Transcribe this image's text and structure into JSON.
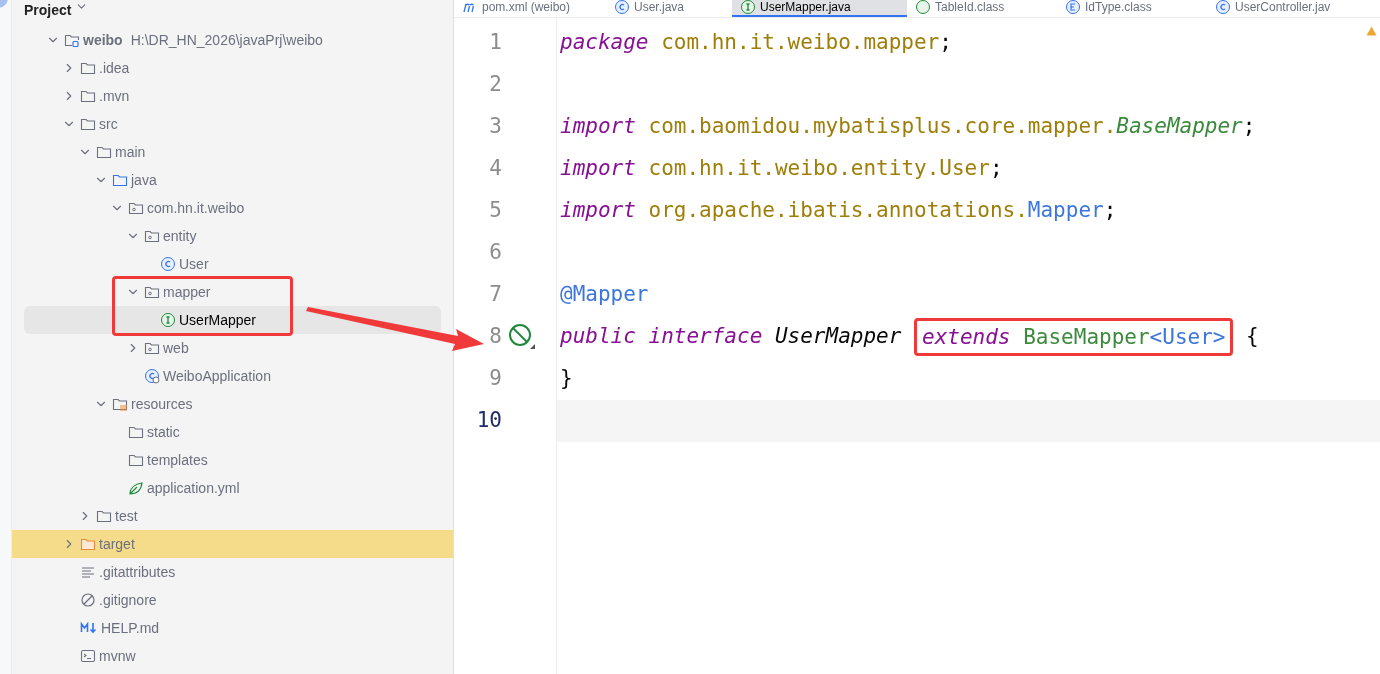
{
  "sidebar": {
    "title": "Project",
    "tree": [
      {
        "label": "weibo",
        "hint": "H:\\DR_HN_2026\\javaPrj\\weibo",
        "kind": "project",
        "expanded": true,
        "selected": false,
        "excluded": false,
        "annotated": false,
        "children": [
          {
            "label": ".idea",
            "kind": "folder",
            "expanded": false,
            "selected": false,
            "excluded": false,
            "annotated": false
          },
          {
            "label": ".mvn",
            "kind": "folder",
            "expanded": false,
            "selected": false,
            "excluded": false,
            "annotated": false
          },
          {
            "label": "src",
            "kind": "folder",
            "expanded": true,
            "selected": false,
            "excluded": false,
            "annotated": false,
            "children": [
              {
                "label": "main",
                "kind": "folder",
                "expanded": true,
                "selected": false,
                "excluded": false,
                "annotated": false,
                "children": [
                  {
                    "label": "java",
                    "kind": "source",
                    "expanded": true,
                    "selected": false,
                    "excluded": false,
                    "annotated": false,
                    "children": [
                      {
                        "label": "com.hn.it.weibo",
                        "kind": "package",
                        "expanded": true,
                        "selected": false,
                        "excluded": false,
                        "annotated": false,
                        "children": [
                          {
                            "label": "entity",
                            "kind": "package",
                            "expanded": true,
                            "selected": false,
                            "excluded": false,
                            "annotated": false,
                            "children": [
                              {
                                "label": "User",
                                "kind": "class",
                                "selected": false,
                                "excluded": false,
                                "annotated": false
                              }
                            ]
                          },
                          {
                            "label": "mapper",
                            "kind": "package",
                            "expanded": true,
                            "selected": false,
                            "excluded": false,
                            "annotated": true,
                            "children": [
                              {
                                "label": "UserMapper",
                                "kind": "interface",
                                "selected": true,
                                "excluded": false,
                                "annotated": true
                              }
                            ]
                          },
                          {
                            "label": "web",
                            "kind": "package",
                            "expanded": false,
                            "selected": false,
                            "excluded": false,
                            "annotated": false
                          },
                          {
                            "label": "WeiboApplication",
                            "kind": "app",
                            "selected": false,
                            "excluded": false,
                            "annotated": false
                          }
                        ]
                      }
                    ]
                  },
                  {
                    "label": "resources",
                    "kind": "resources",
                    "expanded": true,
                    "selected": false,
                    "excluded": false,
                    "annotated": false,
                    "children": [
                      {
                        "label": "static",
                        "kind": "folder",
                        "selected": false,
                        "excluded": false,
                        "annotated": false
                      },
                      {
                        "label": "templates",
                        "kind": "folder",
                        "selected": false,
                        "excluded": false,
                        "annotated": false
                      },
                      {
                        "label": "application.yml",
                        "kind": "yml",
                        "selected": false,
                        "excluded": false,
                        "annotated": false
                      }
                    ]
                  }
                ]
              },
              {
                "label": "test",
                "kind": "folder",
                "expanded": false,
                "selected": false,
                "excluded": false,
                "annotated": false
              }
            ]
          },
          {
            "label": "target",
            "kind": "folder",
            "expanded": false,
            "selected": false,
            "excluded": true,
            "annotated": false
          },
          {
            "label": ".gitattributes",
            "kind": "text",
            "selected": false,
            "excluded": false,
            "annotated": false
          },
          {
            "label": ".gitignore",
            "kind": "ignore",
            "selected": false,
            "excluded": false,
            "annotated": false
          },
          {
            "label": "HELP.md",
            "kind": "markdown",
            "selected": false,
            "excluded": false,
            "annotated": false
          },
          {
            "label": "mvnw",
            "kind": "terminal",
            "selected": false,
            "excluded": false,
            "annotated": false
          }
        ]
      }
    ]
  },
  "tabs": [
    {
      "label": "pom.xml (weibo)",
      "kind": "maven",
      "selected": false
    },
    {
      "label": "User.java",
      "kind": "class",
      "selected": false
    },
    {
      "label": "UserMapper.java",
      "kind": "interface",
      "selected": true
    },
    {
      "label": "TableId.class",
      "kind": "annotation",
      "selected": false
    },
    {
      "label": "IdType.class",
      "kind": "enum",
      "selected": false
    },
    {
      "label": "UserController.jav",
      "kind": "class",
      "selected": false
    }
  ],
  "editor": {
    "lines": [
      {
        "number": "1",
        "kind": "plain",
        "current": false,
        "tokens": [
          {
            "kind": "keyword",
            "text": "package "
          },
          {
            "kind": "package",
            "text": "com.hn.it.weibo.mapper"
          },
          {
            "kind": "plain",
            "text": ";"
          }
        ]
      },
      {
        "number": "2",
        "kind": "plain",
        "current": false
      },
      {
        "number": "3",
        "kind": "plain",
        "current": false,
        "tokens": [
          {
            "kind": "keyword",
            "text": "import "
          },
          {
            "kind": "package",
            "text": "com.baomidou.mybatisplus.core.mapper."
          },
          {
            "kind": "interface_italic",
            "text": "BaseMapper"
          },
          {
            "kind": "plain",
            "text": ";"
          }
        ]
      },
      {
        "number": "4",
        "kind": "plain",
        "current": false,
        "tokens": [
          {
            "kind": "keyword",
            "text": "import "
          },
          {
            "kind": "package",
            "text": "com.hn.it.weibo.entity.User"
          },
          {
            "kind": "plain",
            "text": ";"
          }
        ]
      },
      {
        "number": "5",
        "kind": "plain",
        "current": false,
        "tokens": [
          {
            "kind": "keyword",
            "text": "import "
          },
          {
            "kind": "package",
            "text": "org.apache.ibatis.annotations."
          },
          {
            "kind": "annotation",
            "text": "Mapper"
          },
          {
            "kind": "plain",
            "text": ";"
          }
        ]
      },
      {
        "number": "6",
        "kind": "plain",
        "current": false
      },
      {
        "number": "7",
        "kind": "plain",
        "current": false,
        "tokens": [
          {
            "kind": "annotation",
            "text": "@Mapper"
          }
        ]
      },
      {
        "number": "8",
        "kind": "implemented",
        "current": false,
        "tokens": [
          {
            "kind": "keyword",
            "text": "public interface "
          },
          {
            "kind": "declaration",
            "text": "UserMapper "
          },
          {
            "kind": "box",
            "tokens": [
              {
                "kind": "keyword",
                "text": "extends "
              },
              {
                "kind": "interface",
                "text": "BaseMapper"
              },
              {
                "kind": "annotation",
                "text": "<User>"
              }
            ]
          },
          {
            "kind": "plain",
            "text": " {"
          }
        ]
      },
      {
        "number": "9",
        "kind": "plain",
        "current": false,
        "tokens": [
          {
            "kind": "plain",
            "text": "}"
          }
        ]
      },
      {
        "number": "10",
        "kind": "plain",
        "current": true
      }
    ]
  }
}
